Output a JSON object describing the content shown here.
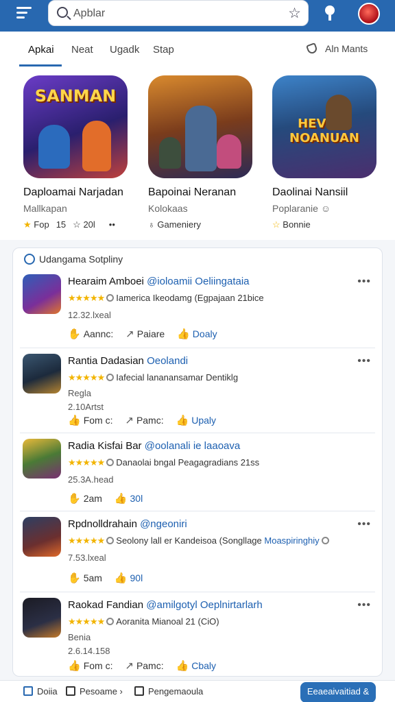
{
  "header": {
    "search_placeholder": "Apblar"
  },
  "tabs": {
    "items": [
      {
        "label": "Apkai"
      },
      {
        "label": "Neat"
      },
      {
        "label": "Ugadk"
      },
      {
        "label": "Stap"
      }
    ],
    "right_label": "Aln Mants"
  },
  "featured": [
    {
      "banner": "SANMAN",
      "title": "Daploamai Narjadan",
      "subtitle": "Mallkapan",
      "meta_a": "Fop",
      "meta_b": "15",
      "meta_c": "20l",
      "meta_more": "••"
    },
    {
      "banner": "",
      "title": "Bapoinai Neranan",
      "subtitle": "Kolokaas",
      "meta_label": "Gameniery"
    },
    {
      "banner": "HEVING NOANUAN",
      "title": "Daolinai Nansiil",
      "subtitle": "Poplaranie",
      "meta_label": "Bonnie"
    }
  ],
  "updates": {
    "title": "Udangama Sotpliny",
    "rows": [
      {
        "name": "Hearaim Amboei",
        "handle": "@ioloamii Oeliingataia",
        "desc": "Iamerica Ikeodamg (Egpajaan 21bice",
        "line1": "12.32.lxeal",
        "line2": "",
        "actions": [
          "Aannc:",
          "Paiare",
          "Doaly"
        ]
      },
      {
        "name": "Rantia Dadasian",
        "handle": "Oeolandi",
        "desc": "Iafecial lananansamar Dentiklg",
        "line1": "Regla",
        "line2": "2.10Artst",
        "actions": [
          "Fom c:",
          "Pamc:",
          "Upaly"
        ]
      },
      {
        "name": "Radia Kisfai Bar",
        "handle": "@oolanali ie laaoava",
        "desc": "Danaolai bngal Peagagradians 21ss",
        "line1": "25.3A.head",
        "line2": "",
        "actions": [
          "2am",
          "30l"
        ]
      },
      {
        "name": "Rpdnolldrahain",
        "handle": "@ngeoniri",
        "desc": "Seolony lall er Kandeisoa (Songllage",
        "desc_blue": "Moaspiringhiy",
        "line1": "7.53.lxeal",
        "line2": "",
        "actions": [
          "5am",
          "90l"
        ]
      },
      {
        "name": "Raokad Fandian",
        "handle": "@amilgotyl Oeplnirtarlarh",
        "desc": "Aoranita Mianoal 21 (CiO)",
        "line1": "Benia",
        "line2": "2.6.14.158",
        "actions": [
          "Fom c:",
          "Pamc:",
          "Cbaly"
        ]
      }
    ]
  },
  "bottom_bar": {
    "item1": "Doiia",
    "item2": "Pesoame",
    "item3": "Pengemaoula",
    "button": "Eeaeaivaitiad &"
  }
}
